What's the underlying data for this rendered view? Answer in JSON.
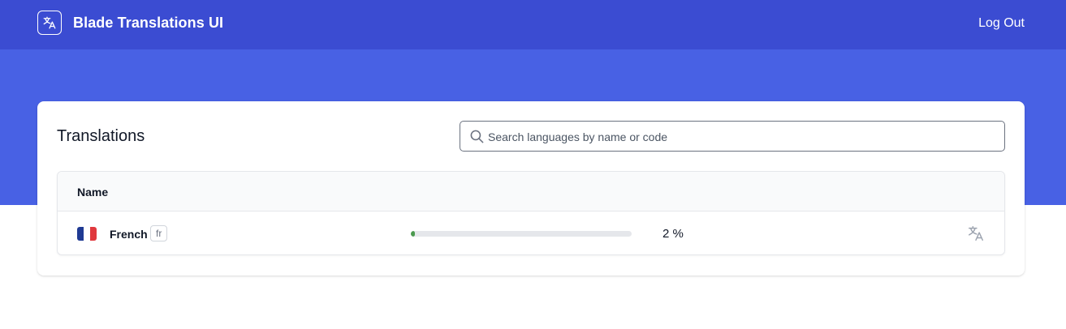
{
  "app": {
    "title": "Blade Translations UI",
    "logout_label": "Log Out",
    "icon": "translate-icon"
  },
  "colors": {
    "navbar": "#3b4cd2",
    "hero": "#4861e4",
    "progress_fill": "#4b9a4f",
    "progress_track": "#e5e7eb"
  },
  "main": {
    "title": "Translations",
    "search": {
      "placeholder": "Search languages by name or code",
      "value": "",
      "icon": "search-icon"
    },
    "table": {
      "columns": [
        "Name"
      ],
      "rows": [
        {
          "flag": "france-flag",
          "name": "French",
          "code": "fr",
          "progress_percent": 2,
          "progress_label": "2 %",
          "action_icon": "translate-icon"
        }
      ]
    }
  }
}
